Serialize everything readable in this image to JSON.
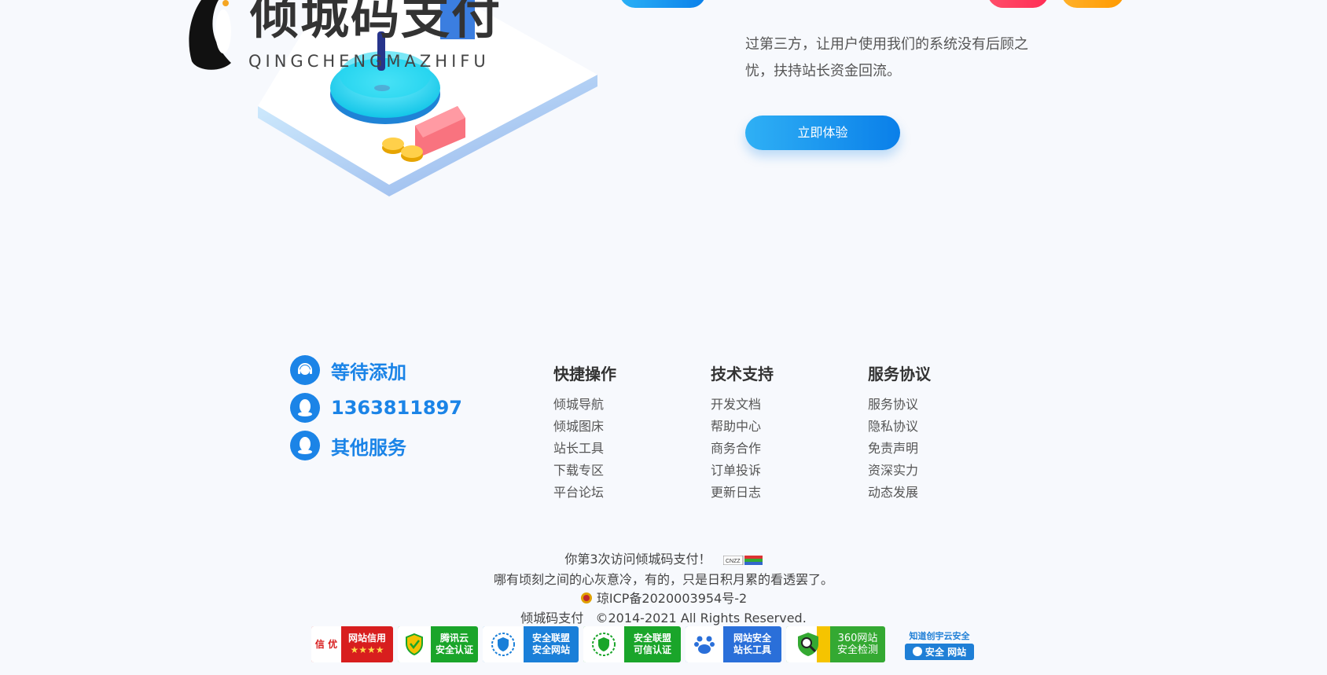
{
  "logo": {
    "title": "倾城码支付",
    "subtitle": "QINGCHENGMAZHIFU"
  },
  "hero": {
    "lines": [
      "过第三方，让用户使用我们的系统没有后顾之",
      "忧，扶持站长资金回流。"
    ],
    "cta_label": "立即体验"
  },
  "contacts": [
    {
      "icon": "support-agent-icon",
      "text": "等待添加"
    },
    {
      "icon": "qq-icon",
      "text": "1363811897"
    },
    {
      "icon": "qq-icon",
      "text": "其他服务"
    }
  ],
  "columns": [
    {
      "heading": "快捷操作",
      "links": [
        "倾城导航",
        "倾城图床",
        "站长工具",
        "下载专区",
        "平台论坛"
      ]
    },
    {
      "heading": "技术支持",
      "links": [
        "开发文档",
        "帮助中心",
        "商务合作",
        "订单投诉",
        "更新日志"
      ]
    },
    {
      "heading": "服务协议",
      "links": [
        "服务协议",
        "隐私协议",
        "免责声明",
        "资深实力",
        "动态发展"
      ]
    }
  ],
  "footer": {
    "visit_text": "你第3次访问倾城码支付！",
    "counter_label": "CNZZ",
    "quote": "哪有顷刻之间的心灰意冷，有的，只是日积月累的看透罢了。",
    "icp": "琼ICP备2020003954号-2",
    "copyright": "倾城码支付   ©2014-2021 All Rights Reserved."
  },
  "badges": [
    {
      "icon": "credit-seal-icon",
      "line1": "信 优",
      "line2": "网站信用",
      "line3": "★★★★",
      "color": "#d81e1e"
    },
    {
      "icon": "shield-icon",
      "line1": "腾讯云",
      "line2": "安全认证",
      "color": "#1aa52a"
    },
    {
      "icon": "shield-laurel-icon",
      "line1": "安全联盟",
      "line2": "安全网站",
      "color": "#1a7fd8"
    },
    {
      "icon": "shield-laurel-icon",
      "line1": "安全联盟",
      "line2": "可信认证",
      "color": "#1aa52a"
    },
    {
      "icon": "baidu-paw-icon",
      "line1": "网站安全",
      "line2": "站长工具",
      "color": "#2a6fd9"
    },
    {
      "icon": "magnifier-shield-icon",
      "line1": "360网站",
      "line2": "安全检测",
      "color": "#34a932"
    },
    {
      "icon": "cloud-shield-icon",
      "line1": "知道创宇云安全",
      "line2": "安全 网站",
      "color": "#1f7fd6"
    }
  ]
}
